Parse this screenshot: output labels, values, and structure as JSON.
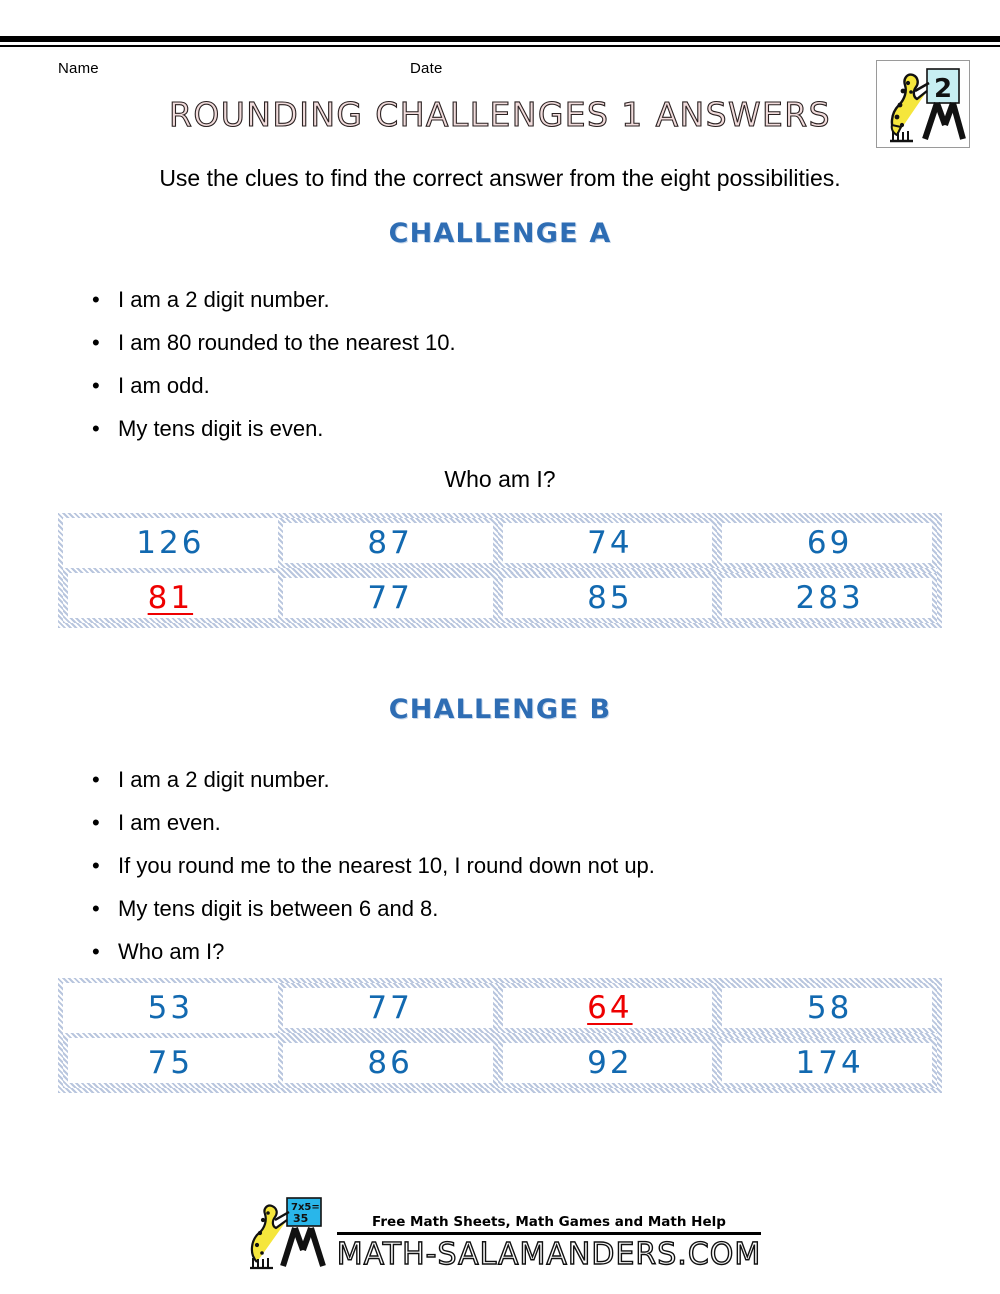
{
  "header": {
    "name_label": "Name",
    "date_label": "Date",
    "title": "ROUNDING CHALLENGES 1 ANSWERS",
    "logo": {
      "icon": "salamander-grade-logo",
      "grade_number": "2"
    }
  },
  "intro": "Use the clues to find the correct answer from the eight possibilities.",
  "challenges": [
    {
      "heading": "CHALLENGE A",
      "clues": [
        "I am a 2 digit number.",
        "I am 80 rounded to the nearest 10.",
        "I am odd.",
        "My tens digit is even."
      ],
      "question": "Who am I?",
      "grid": {
        "rows": [
          [
            {
              "value": "126",
              "is_answer": false
            },
            {
              "value": "87",
              "is_answer": false
            },
            {
              "value": "74",
              "is_answer": false
            },
            {
              "value": "69",
              "is_answer": false
            }
          ],
          [
            {
              "value": "81",
              "is_answer": true
            },
            {
              "value": "77",
              "is_answer": false
            },
            {
              "value": "85",
              "is_answer": false
            },
            {
              "value": "283",
              "is_answer": false
            }
          ]
        ]
      }
    },
    {
      "heading": "CHALLENGE B",
      "clues": [
        "I am a 2 digit number.",
        "I am even.",
        "If you round me to the nearest 10, I round down not up.",
        "My tens digit is between 6 and 8.",
        "Who am I?"
      ],
      "question": "",
      "grid": {
        "rows": [
          [
            {
              "value": "53",
              "is_answer": false
            },
            {
              "value": "77",
              "is_answer": false
            },
            {
              "value": "64",
              "is_answer": true
            },
            {
              "value": "58",
              "is_answer": false
            }
          ],
          [
            {
              "value": "75",
              "is_answer": false
            },
            {
              "value": "86",
              "is_answer": false
            },
            {
              "value": "92",
              "is_answer": false
            },
            {
              "value": "174",
              "is_answer": false
            }
          ]
        ]
      }
    }
  ],
  "bullet_glyph": "•",
  "footer": {
    "logo": {
      "icon": "salamander-math-logo",
      "board_line1": "7x5=",
      "board_line2": "35"
    },
    "tagline": "Free Math Sheets, Math Games and Math Help",
    "domain": "MATH-SALAMANDERS.COM"
  },
  "colors": {
    "heading_blue": "#2e6db4",
    "number_blue": "#1269b0",
    "answer_red": "#ee0000",
    "grid_border": "#b9c6de"
  }
}
